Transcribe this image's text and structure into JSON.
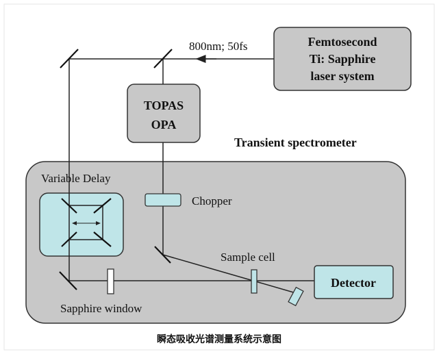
{
  "colors": {
    "box_gray": "#c8c8c8",
    "light_gray": "#d0d0d0",
    "cyan": "#bfe5e8",
    "line": "#222222"
  },
  "labels": {
    "laser_line1": "Femtosecond",
    "laser_line2": "Ti: Sapphire",
    "laser_line3": "laser system",
    "pulse": "800nm; 50fs",
    "topas_line1": "TOPAS",
    "topas_line2": "OPA",
    "spectrometer": "Transient spectrometer",
    "variable_delay": "Variable Delay",
    "chopper": "Chopper",
    "sample_cell": "Sample cell",
    "detector": "Detector",
    "sapphire_window": "Sapphire window",
    "caption": "瞬态吸收光谱测量系统示意图"
  }
}
